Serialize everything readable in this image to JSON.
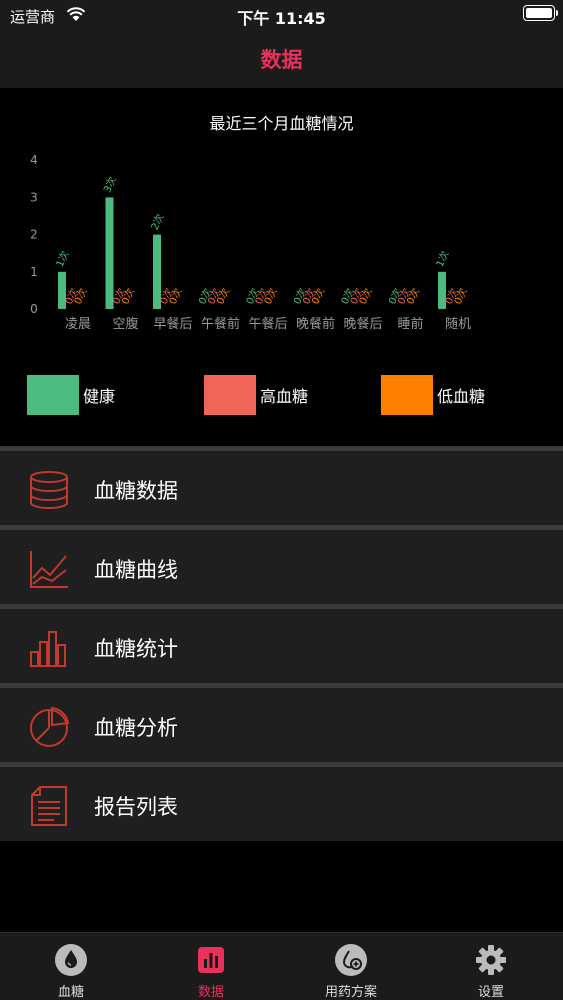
{
  "status_bar": {
    "carrier": "运营商",
    "time": "下午 11:45"
  },
  "nav": {
    "title": "数据"
  },
  "chart_data": {
    "type": "bar",
    "title": "最近三个月血糖情况",
    "categories": [
      "凌晨",
      "空腹",
      "早餐后",
      "午餐前",
      "午餐后",
      "晚餐前",
      "晚餐后",
      "睡前",
      "随机"
    ],
    "series": [
      {
        "name": "健康",
        "color": "#4dbb7f",
        "values": [
          1,
          3,
          2,
          0,
          0,
          0,
          0,
          0,
          1
        ]
      },
      {
        "name": "高血糖",
        "color": "#f0645a",
        "values": [
          0,
          0,
          0,
          0,
          0,
          0,
          0,
          0,
          0
        ]
      },
      {
        "name": "低血糖",
        "color": "#ff8000",
        "values": [
          0,
          0,
          0,
          0,
          0,
          0,
          0,
          0,
          0
        ]
      }
    ],
    "value_suffix": "次",
    "yticks": [
      0,
      1,
      2,
      3,
      4
    ],
    "ylim": [
      0,
      4
    ],
    "legend_position": "bottom"
  },
  "menu": {
    "items": [
      {
        "label": "血糖数据",
        "icon": "database-icon"
      },
      {
        "label": "血糖曲线",
        "icon": "line-chart-icon"
      },
      {
        "label": "血糖统计",
        "icon": "bar-chart-icon"
      },
      {
        "label": "血糖分析",
        "icon": "pie-chart-icon"
      },
      {
        "label": "报告列表",
        "icon": "document-icon"
      }
    ],
    "icon_color": "#c0392b"
  },
  "tabs": [
    {
      "label": "血糖",
      "icon": "blood-drop-icon",
      "active": false
    },
    {
      "label": "数据",
      "icon": "bar-chart-icon",
      "active": true
    },
    {
      "label": "用药方案",
      "icon": "medication-icon",
      "active": false
    },
    {
      "label": "设置",
      "icon": "gear-icon",
      "active": false
    }
  ],
  "colors": {
    "accent": "#e8315b",
    "background": "#000000",
    "panel": "#1f1f1f"
  }
}
